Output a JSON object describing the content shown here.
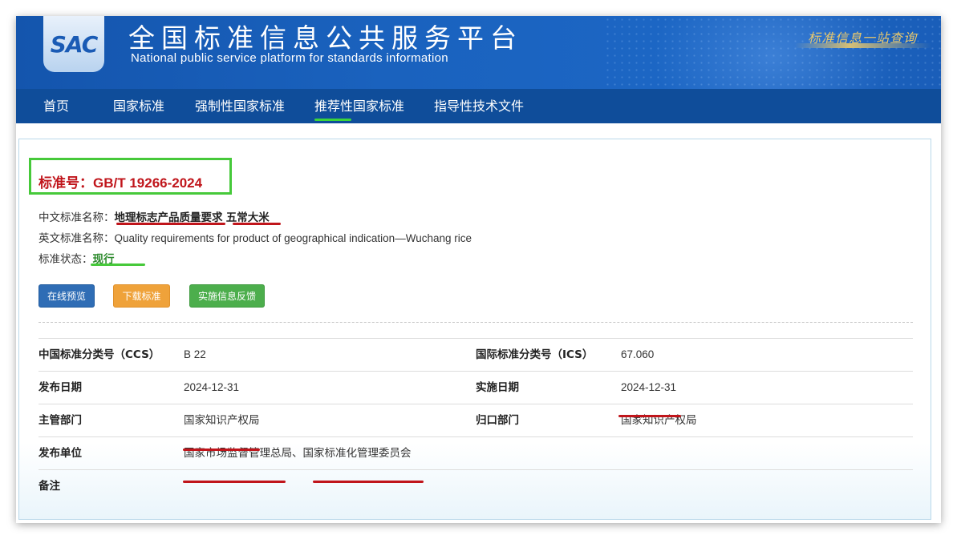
{
  "header": {
    "logo": "SAC",
    "title": "全国标准信息公共服务平台",
    "subtitle": "National public service platform  for standards information",
    "slogan": "标准信息一站查询"
  },
  "nav": {
    "items": [
      "首页",
      "国家标准",
      "强制性国家标准",
      "推荐性国家标准",
      "指导性技术文件"
    ],
    "active_index": 3
  },
  "standard": {
    "number_label": "标准号：",
    "number": "GB/T 19266-2024",
    "cn_name_label": "中文标准名称：",
    "cn_name_part1": "地理标志产品质量要求",
    "cn_name_part2": "五常大米",
    "en_name_label": "英文标准名称：",
    "en_name": "Quality requirements for product of geographical indication—Wuchang rice",
    "status_label": "标准状态：",
    "status": "现行"
  },
  "buttons": {
    "preview": "在线预览",
    "download": "下载标准",
    "feedback": "实施信息反馈"
  },
  "details": {
    "ccs_label": "中国标准分类号（CCS）",
    "ccs": "B 22",
    "ics_label": "国际标准分类号（ICS）",
    "ics": "67.060",
    "publish_date_label": "发布日期",
    "publish_date": "2024-12-31",
    "impl_date_label": "实施日期",
    "impl_date": "2024-12-31",
    "authority_label": "主管部门",
    "authority": "国家知识产权局",
    "centralized_label": "归口部门",
    "centralized": "国家知识产权局",
    "issuer_label": "发布单位",
    "issuer": "国家市场监督管理总局、国家标准化管理委员会",
    "remark_label": "备注",
    "remark": ""
  },
  "colors": {
    "banner": "#1a62be",
    "nav": "#0f4d9a",
    "standard_number": "#c0151b",
    "annotation_red": "#c0151b",
    "annotation_green": "#46c93a",
    "btn_preview": "#2f6db5",
    "btn_download": "#efa23a",
    "btn_feedback": "#4cae4c"
  }
}
